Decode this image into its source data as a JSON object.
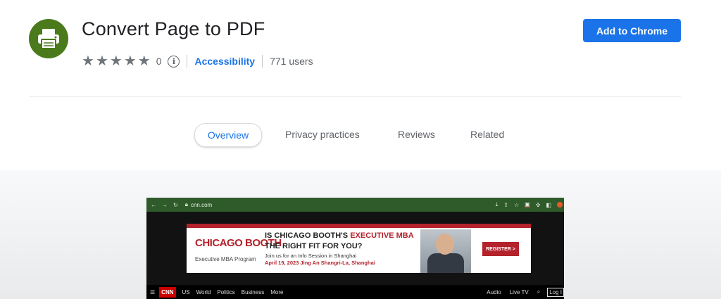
{
  "extension": {
    "title": "Convert Page to PDF",
    "rating_stars": 5,
    "rating_count": "0",
    "category": "Accessibility",
    "users": "771 users",
    "add_button": "Add to Chrome"
  },
  "tabs": [
    {
      "label": "Overview",
      "active": true
    },
    {
      "label": "Privacy practices",
      "active": false
    },
    {
      "label": "Reviews",
      "active": false
    },
    {
      "label": "Related",
      "active": false
    }
  ],
  "screenshot": {
    "url": "cnn.com",
    "ad": {
      "logo": "CHICAGO BOOTH",
      "program": "Executive MBA Program",
      "headline_prefix": "IS CHICAGO BOOTH'S ",
      "headline_highlight": "EXECUTIVE MBA",
      "headline_suffix": " THE RIGHT FIT FOR YOU?",
      "info_line": "Join us for an Info Session in Shanghai",
      "date_line": "April 19, 2023  Jing An Shangri-La, Shanghai",
      "cta": "REGISTER >"
    },
    "nav": {
      "logo": "CNN",
      "items": [
        "US",
        "World",
        "Politics",
        "Business",
        "More"
      ],
      "right_items": [
        "Audio",
        "Live TV"
      ],
      "login": "Log I"
    }
  },
  "colors": {
    "accent": "#1a73e8",
    "icon_bg": "#4a7a1c"
  }
}
